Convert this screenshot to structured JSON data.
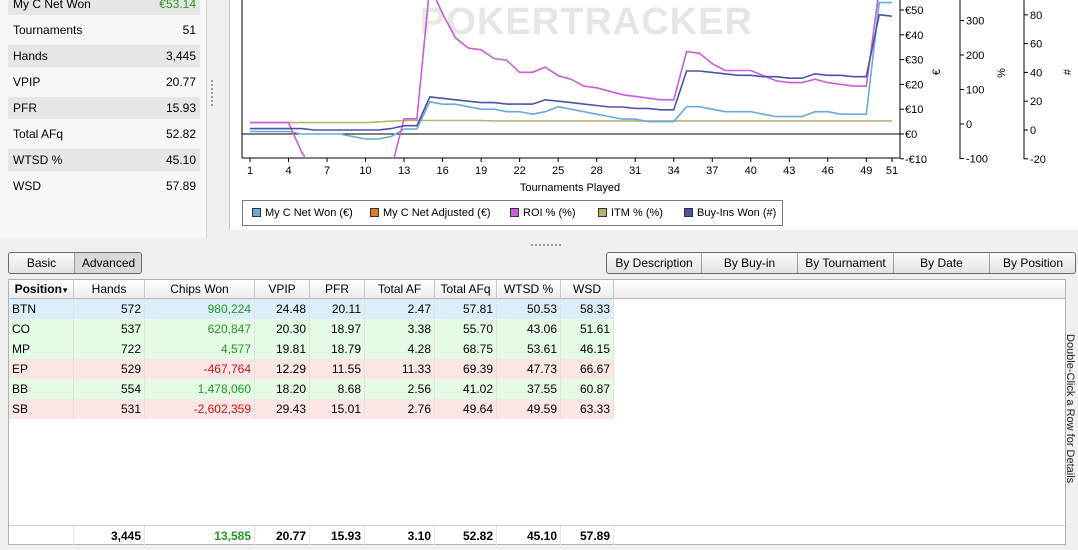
{
  "stats": [
    {
      "label": "My C Net Won",
      "value": "€53.14",
      "color": "#1f9a1f"
    },
    {
      "label": "Tournaments",
      "value": "51"
    },
    {
      "label": "Hands",
      "value": "3,445"
    },
    {
      "label": "VPIP",
      "value": "20.77"
    },
    {
      "label": "PFR",
      "value": "15.93"
    },
    {
      "label": "Total AFq",
      "value": "52.82"
    },
    {
      "label": "WTSD %",
      "value": "45.10"
    },
    {
      "label": "WSD",
      "value": "57.89"
    }
  ],
  "chart": {
    "watermark": "POKERTRACKER",
    "xlabel": "Tournaments Played",
    "x_ticks": [
      "1",
      "4",
      "7",
      "10",
      "13",
      "16",
      "19",
      "22",
      "25",
      "28",
      "31",
      "34",
      "37",
      "40",
      "43",
      "46",
      "49",
      "51"
    ],
    "euro_ticks": [
      "€50",
      "€40",
      "€30",
      "€20",
      "€10",
      "€0",
      "-€10"
    ],
    "euro_axis_label": "€",
    "pct_ticks": [
      "300",
      "200",
      "100",
      "0",
      "-100"
    ],
    "pct_axis_label": "%",
    "count_ticks": [
      "80",
      "60",
      "40",
      "20",
      "0",
      "-20"
    ],
    "count_axis_label": "#"
  },
  "chart_data": {
    "type": "line",
    "x": [
      1,
      2,
      3,
      4,
      5,
      6,
      7,
      8,
      9,
      10,
      11,
      12,
      13,
      14,
      15,
      16,
      17,
      18,
      19,
      20,
      21,
      22,
      23,
      24,
      25,
      26,
      27,
      28,
      29,
      30,
      31,
      32,
      33,
      34,
      35,
      36,
      37,
      38,
      39,
      40,
      41,
      42,
      43,
      44,
      45,
      46,
      47,
      48,
      49,
      50,
      51
    ],
    "xlabel": "Tournaments Played",
    "xlim": [
      0,
      51.5
    ],
    "euro_ylim": [
      -10,
      55
    ],
    "series": [
      {
        "name": "My C Net Won (€)",
        "color": "#6aaad4",
        "axis": "euro",
        "values": [
          1,
          1,
          1,
          1,
          0,
          0,
          0,
          0,
          -1,
          -2,
          -2,
          -1,
          2,
          2,
          13,
          12,
          12,
          11,
          10,
          10,
          9,
          9,
          8,
          9,
          11,
          10,
          9,
          8,
          7,
          6,
          6,
          5,
          5,
          5,
          11,
          11,
          10,
          9,
          9,
          9,
          8,
          7,
          7,
          7,
          9,
          9,
          8,
          8,
          8,
          53,
          53
        ]
      },
      {
        "name": "My C Net Adjusted (€)",
        "color": "#e07b1f",
        "axis": "euro",
        "values": []
      },
      {
        "name": "ROI % (%)",
        "color": "#c95fd8",
        "axis": "pct",
        "values": [
          4,
          4,
          4,
          4,
          -80,
          -140,
          -160,
          -170,
          -180,
          -190,
          -180,
          -130,
          15,
          15,
          400,
          320,
          250,
          220,
          215,
          190,
          185,
          150,
          150,
          165,
          140,
          130,
          110,
          105,
          95,
          85,
          80,
          75,
          70,
          70,
          210,
          205,
          175,
          155,
          155,
          155,
          140,
          125,
          120,
          120,
          130,
          120,
          115,
          110,
          110,
          390,
          385
        ]
      },
      {
        "name": "ITM % (%)",
        "color": "#b4b46e",
        "axis": "pct",
        "values": [
          4,
          4,
          4,
          4,
          4,
          4,
          4,
          4,
          4,
          4,
          6,
          8,
          10,
          10,
          10,
          10,
          10,
          10,
          10,
          9,
          9,
          9,
          9,
          9,
          9,
          9,
          9,
          9,
          9,
          9,
          9,
          9,
          9,
          9,
          9,
          9,
          9,
          9,
          9,
          9,
          9,
          9,
          9,
          9,
          9,
          9,
          9,
          9,
          9,
          9,
          9
        ]
      },
      {
        "name": "Buy-Ins Won (#)",
        "color": "#4c52a8",
        "axis": "count",
        "values": [
          1,
          1,
          1,
          1,
          1,
          0,
          0,
          0,
          0,
          0,
          0,
          1,
          3,
          3,
          23,
          22,
          21,
          20,
          19,
          19,
          18,
          18,
          18,
          21,
          20,
          19,
          18,
          17,
          16,
          16,
          15,
          15,
          14,
          14,
          41,
          41,
          40,
          39,
          38,
          38,
          37,
          37,
          36,
          36,
          39,
          38,
          38,
          37,
          37,
          80,
          79
        ]
      }
    ]
  },
  "legend": [
    "My C Net Won (€)",
    "My C Net Adjusted (€)",
    "ROI % (%)",
    "ITM % (%)",
    "Buy-Ins Won (#)"
  ],
  "legend_colors": [
    "#6aaad4",
    "#e07b1f",
    "#c95fd8",
    "#b4b46e",
    "#4c52a8"
  ],
  "view_tabs": [
    "Basic",
    "Advanced"
  ],
  "group_tabs": [
    "By Description",
    "By Buy-in",
    "By Tournament",
    "By Date",
    "By Position"
  ],
  "table": {
    "headers": [
      "Position",
      "Hands",
      "Chips Won",
      "VPIP",
      "PFR",
      "Total AF",
      "Total AFq",
      "WTSD %",
      "WSD"
    ],
    "rows": [
      {
        "bg": "#ddeefb",
        "cells": [
          "BTN",
          "572",
          "980,224",
          "24.48",
          "20.11",
          "2.47",
          "57.81",
          "50.53",
          "58.33"
        ],
        "sign": "pos"
      },
      {
        "bg": "#e6fbe6",
        "cells": [
          "CO",
          "537",
          "620,847",
          "20.30",
          "18.97",
          "3.38",
          "55.70",
          "43.06",
          "51.61"
        ],
        "sign": "pos"
      },
      {
        "bg": "#e6fbe6",
        "cells": [
          "MP",
          "722",
          "4,577",
          "19.81",
          "18.79",
          "4.28",
          "68.75",
          "53.61",
          "46.15"
        ],
        "sign": "pos"
      },
      {
        "bg": "#fbe6e6",
        "cells": [
          "EP",
          "529",
          "-467,764",
          "12.29",
          "11.55",
          "11.33",
          "69.39",
          "47.73",
          "66.67"
        ],
        "sign": "neg"
      },
      {
        "bg": "#e6fbe6",
        "cells": [
          "BB",
          "554",
          "1,478,060",
          "18.20",
          "8.68",
          "2.56",
          "41.02",
          "37.55",
          "60.87"
        ],
        "sign": "pos"
      },
      {
        "bg": "#fbe6e6",
        "cells": [
          "SB",
          "531",
          "-2,602,359",
          "29.43",
          "15.01",
          "2.76",
          "49.64",
          "49.59",
          "63.33"
        ],
        "sign": "neg"
      }
    ],
    "totals": [
      "",
      "3,445",
      "13,585",
      "20.77",
      "15.93",
      "3.10",
      "52.82",
      "45.10",
      "57.89"
    ]
  },
  "side_note": "Double-Click a Row for Details"
}
